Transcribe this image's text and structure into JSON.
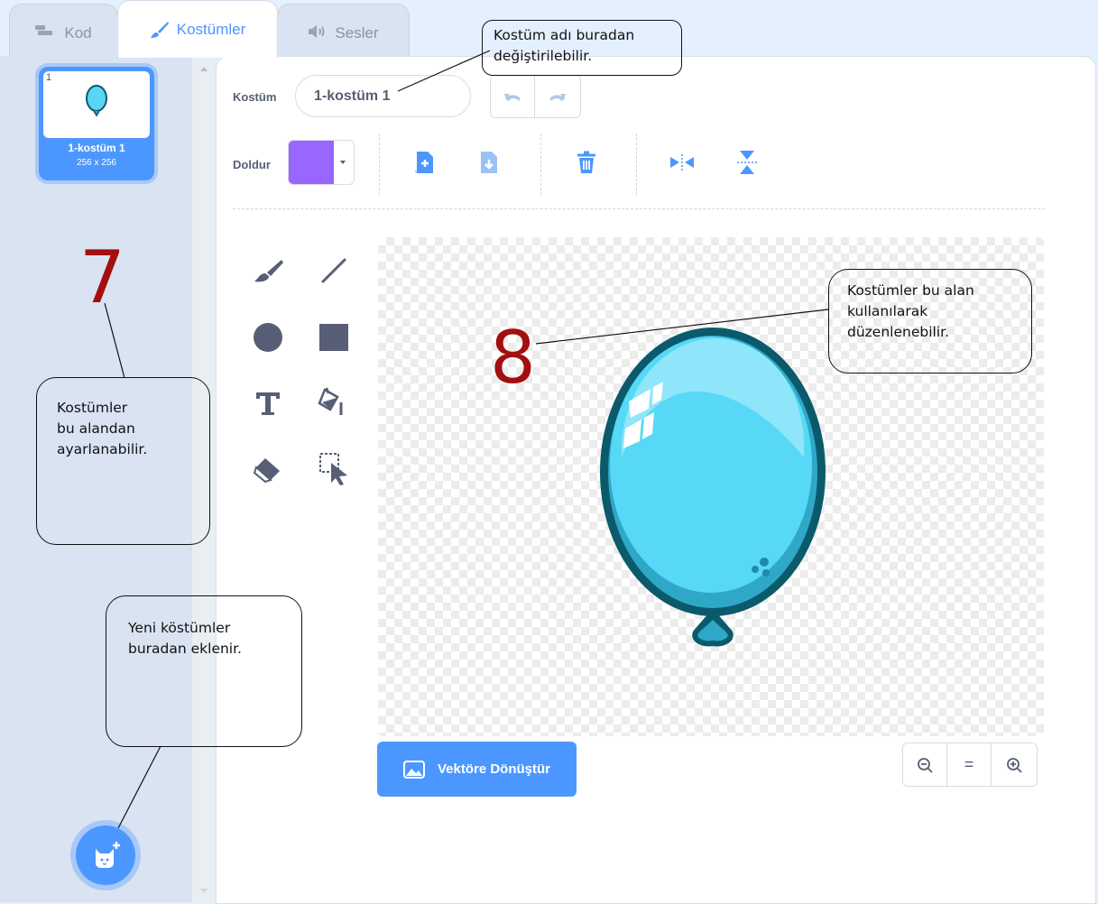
{
  "tabs": [
    {
      "label": "Kod",
      "icon": "code-blocks-icon",
      "active": false
    },
    {
      "label": "Kostümler",
      "icon": "paintbrush-icon",
      "active": true
    },
    {
      "label": "Sesler",
      "icon": "speaker-icon",
      "active": false
    }
  ],
  "costume_list": {
    "items": [
      {
        "number": "1",
        "name": "1-kostüm 1",
        "size": "256 x 256",
        "selected": true
      }
    ],
    "add_button_icon": "cat-add-icon"
  },
  "toolbar": {
    "costume_label": "Kostüm",
    "costume_name_value": "1-kostüm 1",
    "fill_label": "Doldur",
    "fill_color": "#9966ff",
    "undo_icon": "undo-icon",
    "redo_icon": "redo-icon",
    "actions": [
      "forward-layer-icon",
      "backward-layer-icon",
      "delete-icon",
      "flip-horizontal-icon",
      "flip-vertical-icon"
    ]
  },
  "tools": [
    "brush-icon",
    "line-icon",
    "circle-icon",
    "rectangle-icon",
    "text-icon",
    "fill-bucket-icon",
    "eraser-icon",
    "select-icon"
  ],
  "canvas": {
    "content": "balloon-costume"
  },
  "convert_button": {
    "label": "Vektöre Dönüştür",
    "icon": "image-icon"
  },
  "zoom": {
    "out_icon": "zoom-out-icon",
    "reset_label": "=",
    "in_icon": "zoom-in-icon"
  },
  "annotations": {
    "name_callout": [
      "Kostüm adı buradan",
      "değiştirilebilir."
    ],
    "list_number": "7",
    "list_callout": [
      "Kostümler",
      "bu alandan",
      "ayarlanabilir."
    ],
    "canvas_number": "8",
    "canvas_callout": [
      "Kostümler bu alan",
      "kullanılarak",
      "düzenlenebilir."
    ],
    "add_callout": [
      "Yeni köstümler",
      "buradan eklenir."
    ]
  }
}
